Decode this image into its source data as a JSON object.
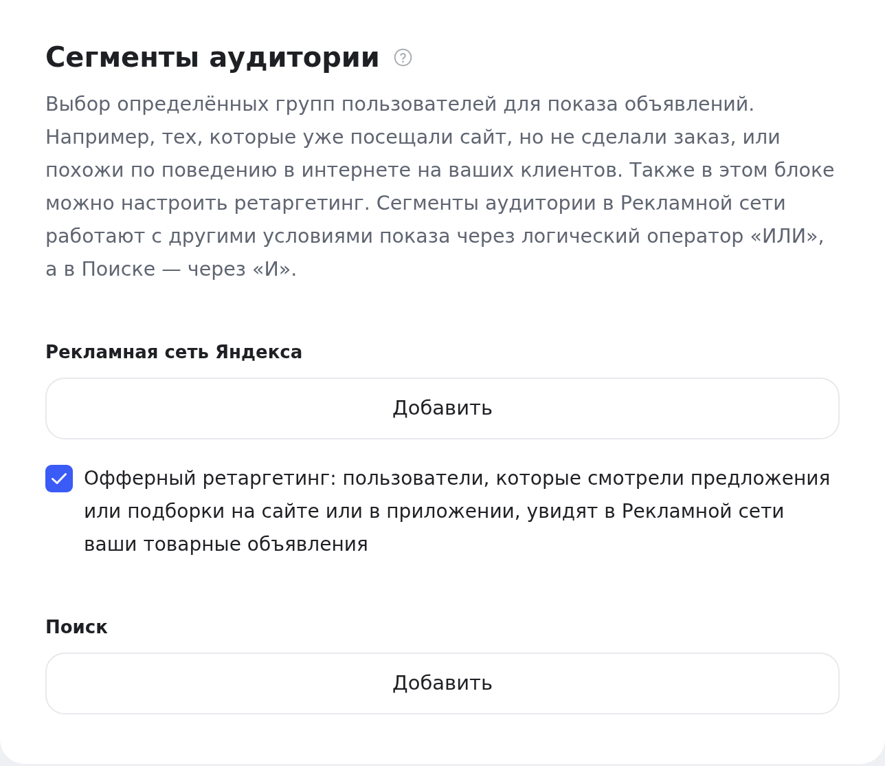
{
  "title": "Сегменты аудитории",
  "description": "Выбор определённых групп пользователей для показа объявлений. Например, тех, которые уже посещали сайт, но не сделали заказ, или похожи по поведению в интернете на ваших клиентов. Также в этом блоке можно настроить ретаргетинг. Сегменты аудитории в Рекламной сети работают с другими условиями показа через логический оператор «ИЛИ», а в Поиске — через «И».",
  "sections": [
    {
      "heading": "Рекламная сеть Яндекса",
      "button": "Добавить",
      "options": [
        {
          "label": "Офферный ретаргетинг: пользователи, которые смотрели предложения или подборки на сайте или в приложении, увидят в Рекламной сети ваши товарные объявления",
          "checked": true
        }
      ]
    },
    {
      "heading": "Поиск",
      "button": "Добавить"
    }
  ]
}
